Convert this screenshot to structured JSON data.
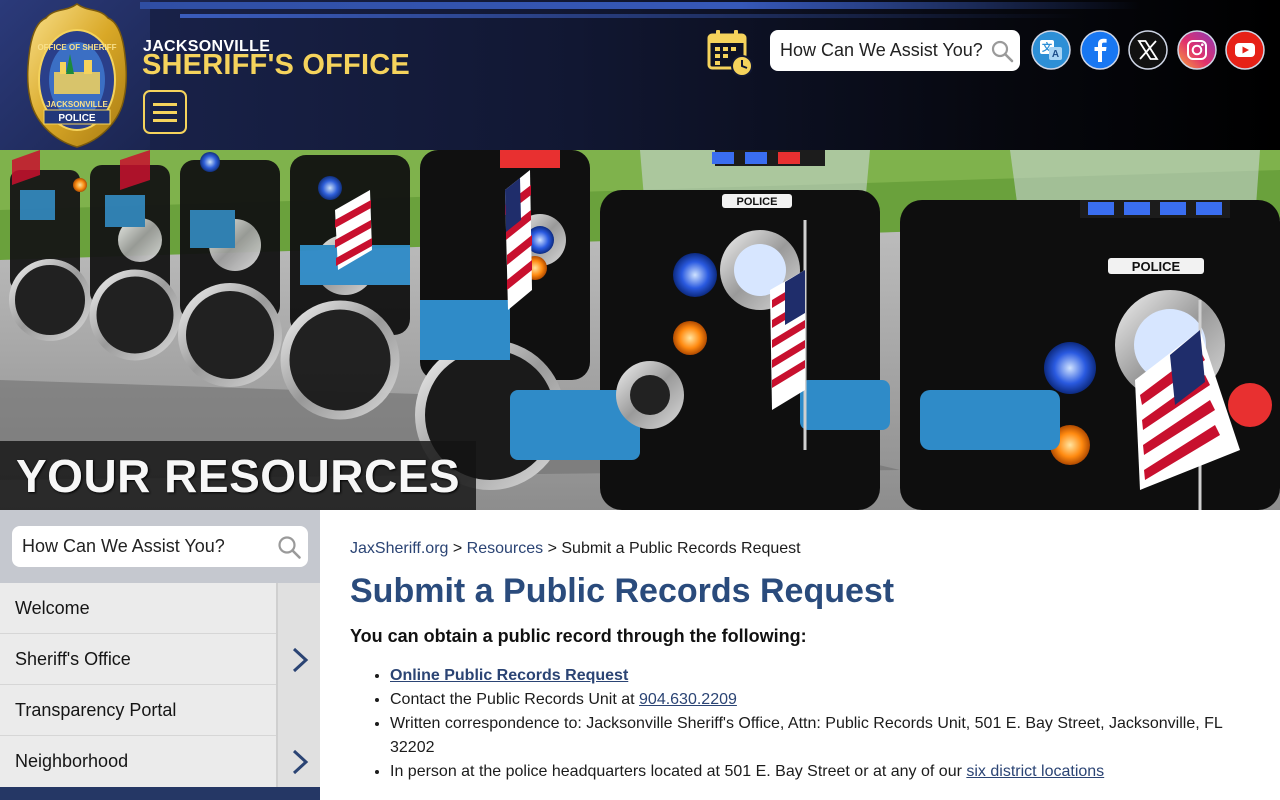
{
  "header": {
    "brand_small": "JACKSONVILLE",
    "brand_big": "SHERIFF'S OFFICE",
    "search_placeholder": "How Can We Assist You?",
    "badge": {
      "top_text": "OFFICE OF SHERIFF",
      "bottom_text": "JACKSONVILLE",
      "ribbon": "POLICE"
    },
    "social": [
      {
        "name": "translate-icon",
        "color": "#2d8fd6"
      },
      {
        "name": "facebook-icon",
        "color": "#1877f2"
      },
      {
        "name": "x-twitter-icon",
        "color": "#000000"
      },
      {
        "name": "instagram-icon",
        "color": "#e1306c"
      },
      {
        "name": "youtube-icon",
        "color": "#e62117"
      }
    ]
  },
  "hero": {
    "title": "YOUR RESOURCES",
    "fairing_text": "POLICE"
  },
  "sidebar": {
    "search_placeholder": "How Can We Assist You?",
    "items": [
      {
        "label": "Welcome",
        "has_submenu": false
      },
      {
        "label": "Sheriff's Office",
        "has_submenu": true
      },
      {
        "label": "Transparency Portal",
        "has_submenu": false
      },
      {
        "label": "Neighborhood",
        "has_submenu": true
      }
    ]
  },
  "main": {
    "breadcrumb": {
      "home": "JaxSheriff.org",
      "sep1": " > ",
      "section": "Resources",
      "sep2": " > ",
      "current": "Submit a Public Records Request"
    },
    "title": "Submit a Public Records Request",
    "intro": "You can obtain a public record through the following:",
    "list": {
      "online_link": "Online Public Records Request",
      "contact_prefix": "Contact the Public Records Unit at ",
      "contact_phone": "904.630.2209",
      "written": "Written correspondence to: Jacksonville Sheriff's Office, Attn: Public Records Unit, 501 E. Bay Street, Jacksonville, FL 32202",
      "inperson_prefix": "In person at the police headquarters located at 501 E. Bay Street or at any of our ",
      "inperson_link": "six district locations"
    }
  },
  "colors": {
    "gold": "#f5d35c",
    "navy": "#1b2550",
    "title_blue": "#2a4b7c",
    "link_blue": "#2b4474"
  }
}
